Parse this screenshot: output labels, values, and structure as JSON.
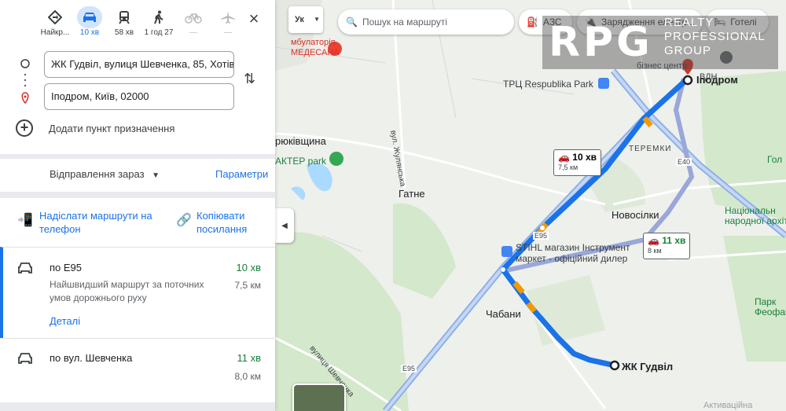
{
  "modes": [
    {
      "icon": "best-route-icon",
      "label": "Найкр..."
    },
    {
      "icon": "car-icon",
      "label": "10 хв",
      "active": true
    },
    {
      "icon": "transit-icon",
      "label": "58 хв"
    },
    {
      "icon": "walk-icon",
      "label": "1 год 27"
    },
    {
      "icon": "bike-icon",
      "label": "—",
      "disabled": true
    },
    {
      "icon": "flight-icon",
      "label": "—",
      "disabled": true
    }
  ],
  "origin": "ЖК Гудвіл, вулиця Шевченка, 85, Хотів, ",
  "destination": "Іподром, Київ, 02000",
  "add_destination": "Додати пункт призначення",
  "depart_now": "Відправлення зараз",
  "options": "Параметри",
  "send_to_phone": "Надіслати маршрути на телефон",
  "copy_links": "Копіювати посилання",
  "routes": [
    {
      "name": "по E95",
      "time": "10 хв",
      "desc": "Найшвидший маршрут за поточних умов дорожнього руху",
      "dist": "7,5 км",
      "details": "Деталі"
    },
    {
      "name": "по вул. Шевченка",
      "time": "11 хв",
      "dist": "8,0 км"
    }
  ],
  "map": {
    "language": "Ук",
    "search_placeholder": "Пошук на маршруті",
    "chips": [
      "АЗС",
      "Зарядження електр...",
      "Готелі"
    ],
    "bubble1": {
      "time": "10 хв",
      "dist": "7,5 км"
    },
    "bubble2": {
      "time": "11 хв",
      "dist": "8 км"
    },
    "labels": {
      "ambulance": "мбулаторія\nМЕДЕСАНА",
      "respublika": "ТРЦ Respublika Park",
      "ipodrom": "Іподром",
      "teremky": "ТЕРЕМКИ",
      "yukivshchyna": "рюківщина",
      "akter": "АКТЕР park",
      "zhulyanska": "вул. Жулянська",
      "gatne": "Гатне",
      "novosilky": "Новосілки",
      "stihl": "STIHL магазин Інструмент\nмаркет - офіційний дилер",
      "chabany": "Чабани",
      "goodwill": "ЖК Гудвіл",
      "national": "Національн\nнародної архіт",
      "park": "Парк\nФеофані",
      "e95a": "E95",
      "e95b": "E95",
      "e40": "E40",
      "bus_center": "бізнес центр",
      "vdnh": "ВДН",
      "gol": "Гол",
      "shevchenka_st": "вулиця Шевченка",
      "aktyvatsiya": "Активаційна"
    }
  },
  "watermark": {
    "big": "RPG",
    "small": "REALTY\nPROFESSIONAL\nGROUP"
  }
}
